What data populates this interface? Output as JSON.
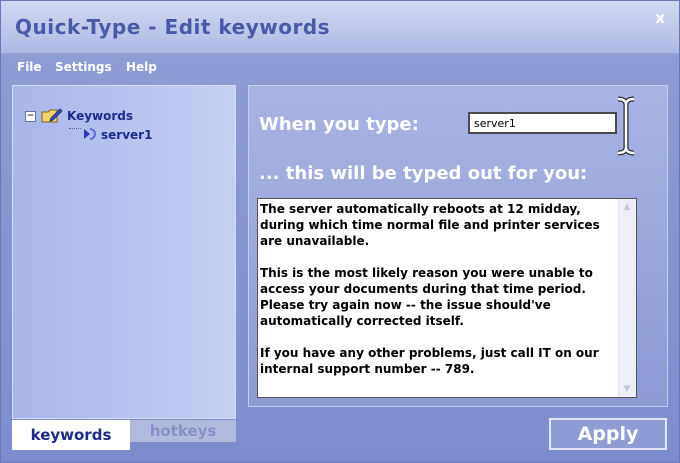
{
  "window": {
    "title": "Quick-Type - Edit keywords",
    "close": "x"
  },
  "menu": {
    "items": [
      "File",
      "Settings",
      "Help"
    ]
  },
  "tree": {
    "root": "Keywords",
    "child": "server1"
  },
  "tabs": {
    "keywords": "keywords",
    "hotkeys": "hotkeys"
  },
  "editor": {
    "when_label": "When you type:",
    "keyword_value": "server1",
    "typed_label": "... this will be typed out for you:",
    "body": "The server automatically reboots at 12 midday, during which time normal file and printer services are unavailable.\n\nThis is the most likely reason you were unable to access your documents during that time period. Please try again now -- the issue should've automatically corrected itself.\n\nIf you have any other problems, just call IT on our internal support number -- 789."
  },
  "apply_label": "Apply",
  "icons": {
    "folder": "folder-pen-icon",
    "node": "keyword-node-icon",
    "cursor": "ibeam-cursor-icon"
  }
}
